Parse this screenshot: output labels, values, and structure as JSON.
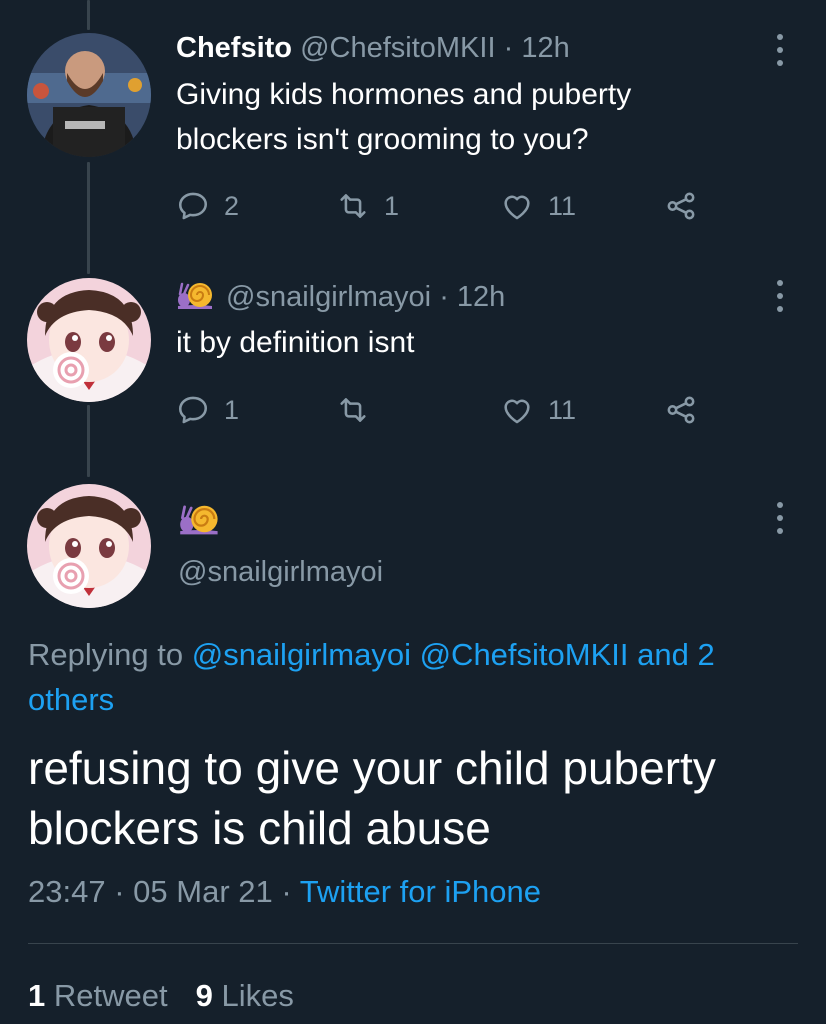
{
  "tweets": [
    {
      "display_name": "Chefsito",
      "handle": "@ChefsitoMKII",
      "sep": "·",
      "time": "12h",
      "text_line1": "Giving kids hormones and puberty",
      "text_line2": "blockers isn't grooming to you?",
      "replies": "2",
      "retweets": "1",
      "likes": "11"
    },
    {
      "name_emoji": "snail-emoji",
      "handle": "@snailgirlmayoi",
      "sep": "·",
      "time": "12h",
      "text": "it by definition isnt",
      "replies": "1",
      "retweets": "",
      "likes": "11"
    }
  ],
  "focused": {
    "name_emoji": "snail-emoji",
    "handle": "@snailgirlmayoi",
    "replying_prefix": "Replying to",
    "replying_links": "@snailgirlmayoi @ChefsitoMKII and 2",
    "replying_links_cont": "others",
    "text_line1": "refusing to give your child puberty",
    "text_line2": "blockers is child abuse",
    "time": "23:47",
    "date": "05 Mar 21",
    "sep": "·",
    "source": "Twitter for iPhone",
    "retweet_count": "1",
    "retweet_label": "Retweet",
    "like_count": "9",
    "like_label": "Likes"
  },
  "icons": [
    "reply-icon",
    "retweet-icon",
    "like-icon",
    "share-icon",
    "more-icon"
  ],
  "colors": {
    "background": "#15202b",
    "secondary_text": "#8899a6",
    "link": "#1da1f2",
    "divider": "#38444d"
  }
}
